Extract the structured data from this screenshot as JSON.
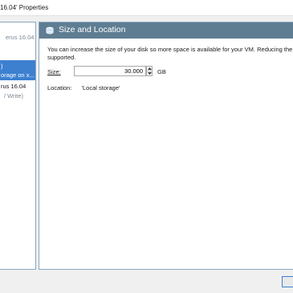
{
  "window": {
    "title": "16.04' Properties"
  },
  "sidebar": {
    "items": [
      {
        "line1": "erus 16.04"
      },
      {
        "line1": ")",
        "line2": "orage on x..."
      },
      {
        "line1": "rus 16.04",
        "line2": "/ Write)"
      }
    ]
  },
  "panel": {
    "header_title": "Size and Location",
    "description_line1": "You can increase the size of your disk so more space is available for your VM. Reducing the s",
    "description_line2": "supported.",
    "size_label": "Size:",
    "size_value": "30.000",
    "size_unit": "GB",
    "location_label": "Location:",
    "location_value": "'Local storage'"
  },
  "colors": {
    "header_bg": "#5f7d92",
    "selection": "#3d80d0",
    "border": "#8aa6bf"
  }
}
